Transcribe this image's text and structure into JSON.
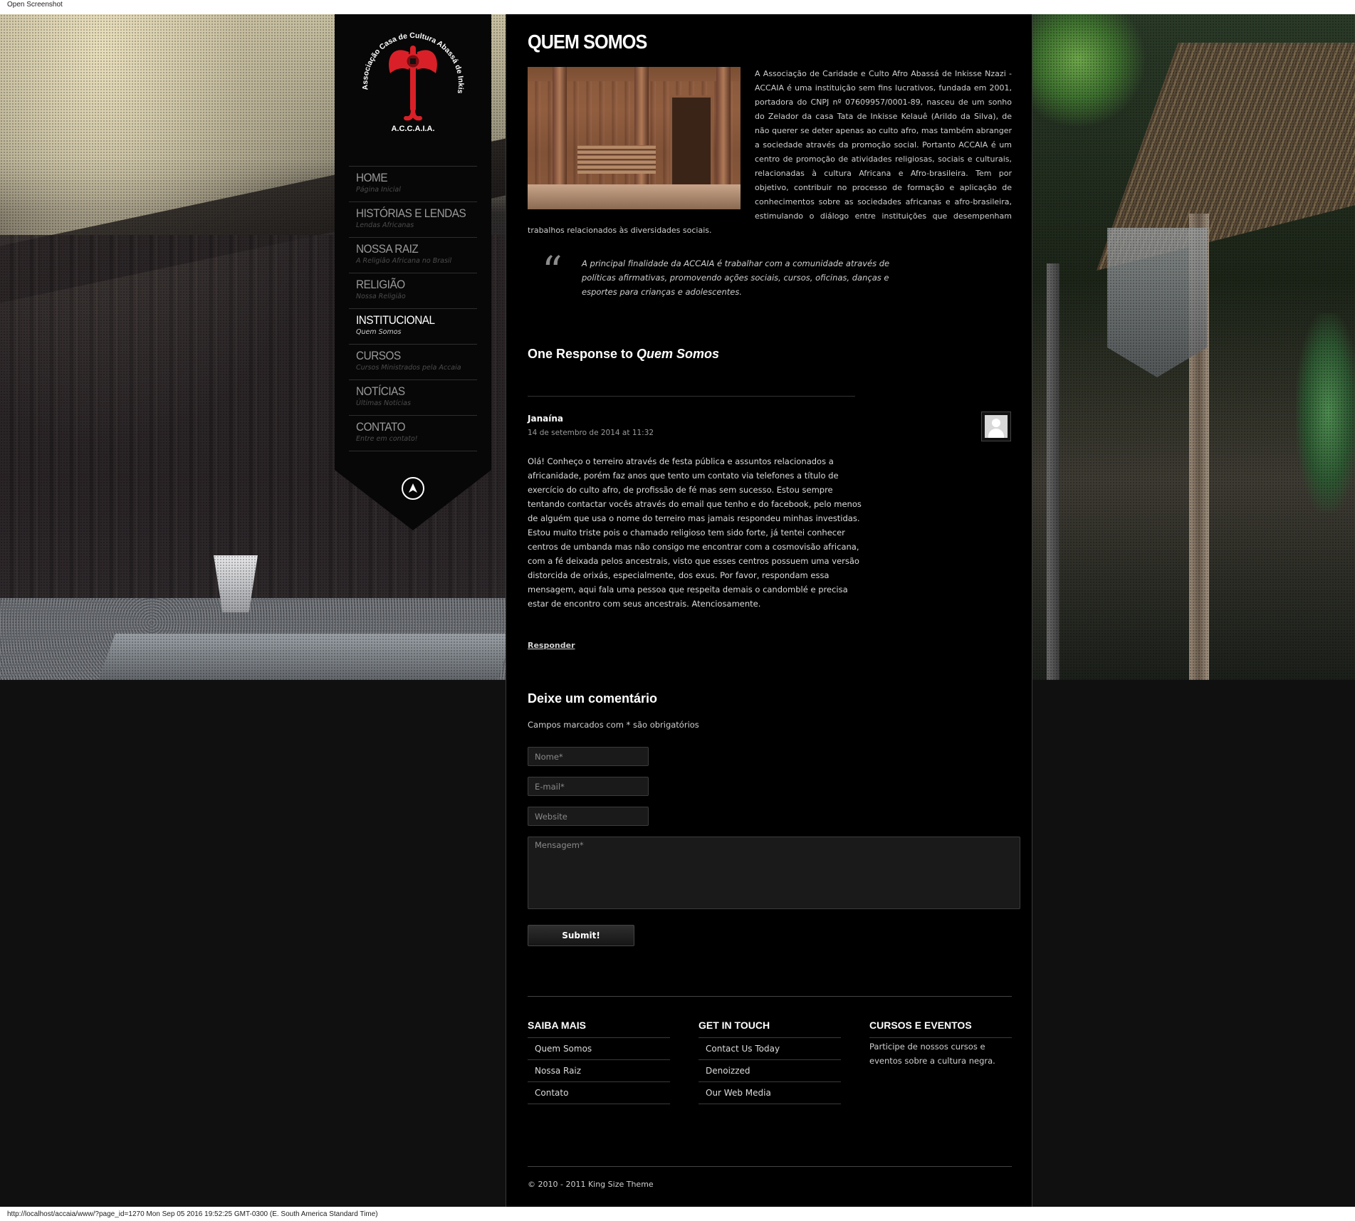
{
  "window": {
    "header_text": "Open Screenshot",
    "status_text": "http://localhost/accaia/www/?page_id=1270 Mon Sep 05 2016 19:52:25 GMT-0300 (E. South America Standard Time)"
  },
  "logo": {
    "arc_text": "Associação Casa de Cultura Abassá de Inkise Nzazi",
    "acronym": "A.C.C.A.I.A.",
    "colors": {
      "emblem": "#d92028",
      "text": "#ffffff"
    }
  },
  "nav": {
    "items": [
      {
        "title": "HOME",
        "subtitle": "Página Inicial"
      },
      {
        "title": "HISTÓRIAS E LENDAS",
        "subtitle": "Lendas Africanas"
      },
      {
        "title": "NOSSA RAIZ",
        "subtitle": "A Religião Africana no Brasil"
      },
      {
        "title": "RELIGIÃO",
        "subtitle": "Nossa Religião"
      },
      {
        "title": "INSTITUCIONAL",
        "subtitle": "Quem Somos"
      },
      {
        "title": "CURSOS",
        "subtitle": "Cursos Ministrados pela Accaia"
      },
      {
        "title": "NOTÍCIAS",
        "subtitle": "Últimas Notícias"
      },
      {
        "title": "CONTATO",
        "subtitle": "Entre em contato!"
      }
    ],
    "active_index": 4,
    "up_icon": "navigation-arrow-icon"
  },
  "page": {
    "title": "QUEM SOMOS",
    "intro": "A Associação de Caridade e Culto Afro Abassá de Inkisse Nzazi - ACCAIA é uma instituição sem fins lucrativos, fundada em 2001, portadora do CNPJ nº 07609957/0001-89, nasceu de um sonho do Zelador da casa Tata de Inkisse Kelauê (Arildo da Silva), de não querer se deter apenas ao culto afro, mas também abranger a sociedade através da promoção social. Portanto ACCAIA é um centro de promoção de atividades religiosas, sociais e culturais, relacionadas à cultura Africana e Afro-brasileira. Tem por objetivo, contribuir no processo de formação e aplicação de conhecimentos sobre as sociedades africanas e afro-brasileira, estimulando o diálogo entre instituições que desempenham trabalhos relacionados às diversidades sociais.",
    "quote_mark": "“",
    "quote": "A principal finalidade da ACCAIA é trabalhar com a comunidade através de políticas afirmativas, promovendo ações sociais, cursos, oficinas, danças e esportes para crianças e adolescentes."
  },
  "comments": {
    "title_prefix": "One Response to ",
    "title_post": "Quem Somos",
    "items": [
      {
        "author": "Janaína",
        "date": "14 de setembro de 2014 at 11:32",
        "body": "Olá! Conheço o terreiro através de festa pública e assuntos relacionados a africanidade, porém faz anos que tento um contato via telefones a título de exercício do culto afro, de profissão de fé mas sem sucesso. Estou sempre tentando contactar vocês através do email que tenho e do facebook, pelo menos de alguém que usa o nome do terreiro mas jamais respondeu minhas investidas. Estou muito triste pois o chamado religioso tem sido forte, já tentei conhecer centros de umbanda mas não consigo me encontrar com a cosmovisão africana, com a fé deixada pelos ancestrais, visto que esses centros possuem uma versão distorcida de orixás, especialmente, dos exus. Por favor, respondam essa mensagem, aqui fala uma pessoa que respeita demais o candomblé e precisa estar de encontro com seus ancestrais. Atenciosamente.",
        "reply_label": "Responder"
      }
    ]
  },
  "comment_form": {
    "title": "Deixe um comentário",
    "required_note": "Campos marcados com * são obrigatórios",
    "name_placeholder": "Nome*",
    "email_placeholder": "E-mail*",
    "website_placeholder": "Website",
    "message_placeholder": "Mensagem*",
    "submit_label": "Submit!"
  },
  "footer": {
    "columns": [
      {
        "title": "SAIBA MAIS",
        "links": [
          "Quem Somos",
          "Nossa Raiz",
          "Contato"
        ]
      },
      {
        "title": "GET IN TOUCH",
        "links": [
          "Contact Us Today",
          "Denoizzed",
          "Our Web Media"
        ]
      },
      {
        "title": "CURSOS E EVENTOS",
        "text": "Participe de nossos cursos e eventos sobre a cultura negra."
      }
    ],
    "copyright": "© 2010 - 2011 King Size Theme"
  }
}
